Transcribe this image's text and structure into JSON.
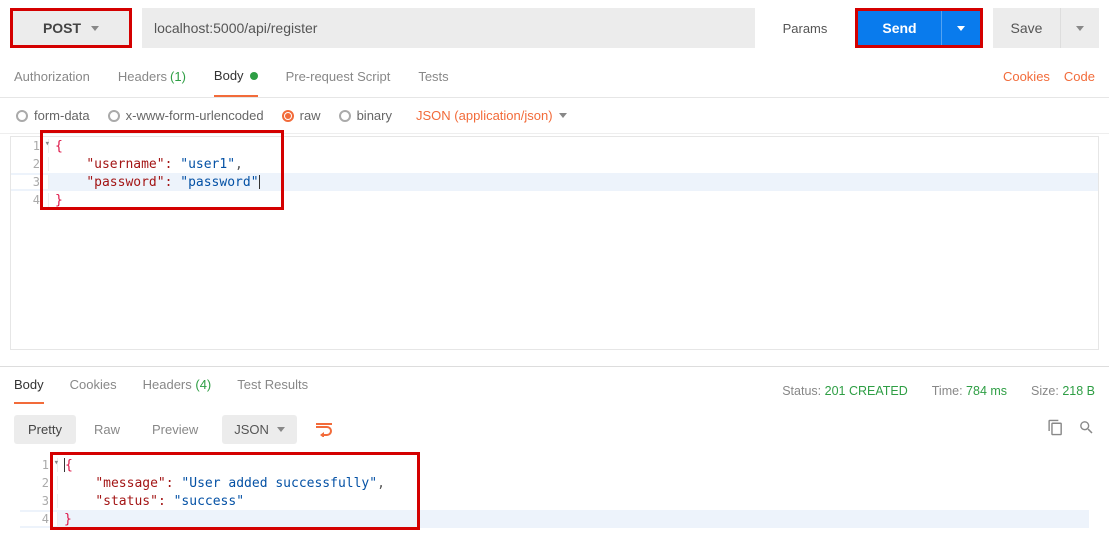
{
  "request": {
    "method": "POST",
    "url": "localhost:5000/api/register",
    "params_label": "Params",
    "send_label": "Send",
    "save_label": "Save"
  },
  "req_tabs": {
    "authorization": "Authorization",
    "headers": "Headers",
    "headers_count": "(1)",
    "body": "Body",
    "prerequest": "Pre-request Script",
    "tests": "Tests",
    "cookies_link": "Cookies",
    "code_link": "Code"
  },
  "body_types": {
    "form_data": "form-data",
    "url_encoded": "x-www-form-urlencoded",
    "raw": "raw",
    "binary": "binary",
    "selected": "raw",
    "content_type": "JSON (application/json)"
  },
  "request_body_lines": {
    "l1": "{",
    "l2_key": "\"username\"",
    "l2_val": "\"user1\"",
    "l3_key": "\"password\"",
    "l3_val": "\"password\"",
    "l4": "}"
  },
  "resp_tabs": {
    "body": "Body",
    "cookies": "Cookies",
    "headers": "Headers",
    "headers_count": "(4)",
    "tests": "Test Results"
  },
  "response_meta": {
    "status_label": "Status:",
    "status_value": "201 CREATED",
    "time_label": "Time:",
    "time_value": "784 ms",
    "size_label": "Size:",
    "size_value": "218 B"
  },
  "resp_toolbar": {
    "pretty": "Pretty",
    "raw": "Raw",
    "preview": "Preview",
    "json": "JSON"
  },
  "response_body_lines": {
    "l1": "{",
    "l2_key": "\"message\"",
    "l2_val": "\"User added successfully\"",
    "l3_key": "\"status\"",
    "l3_val": "\"success\"",
    "l4": "}"
  }
}
